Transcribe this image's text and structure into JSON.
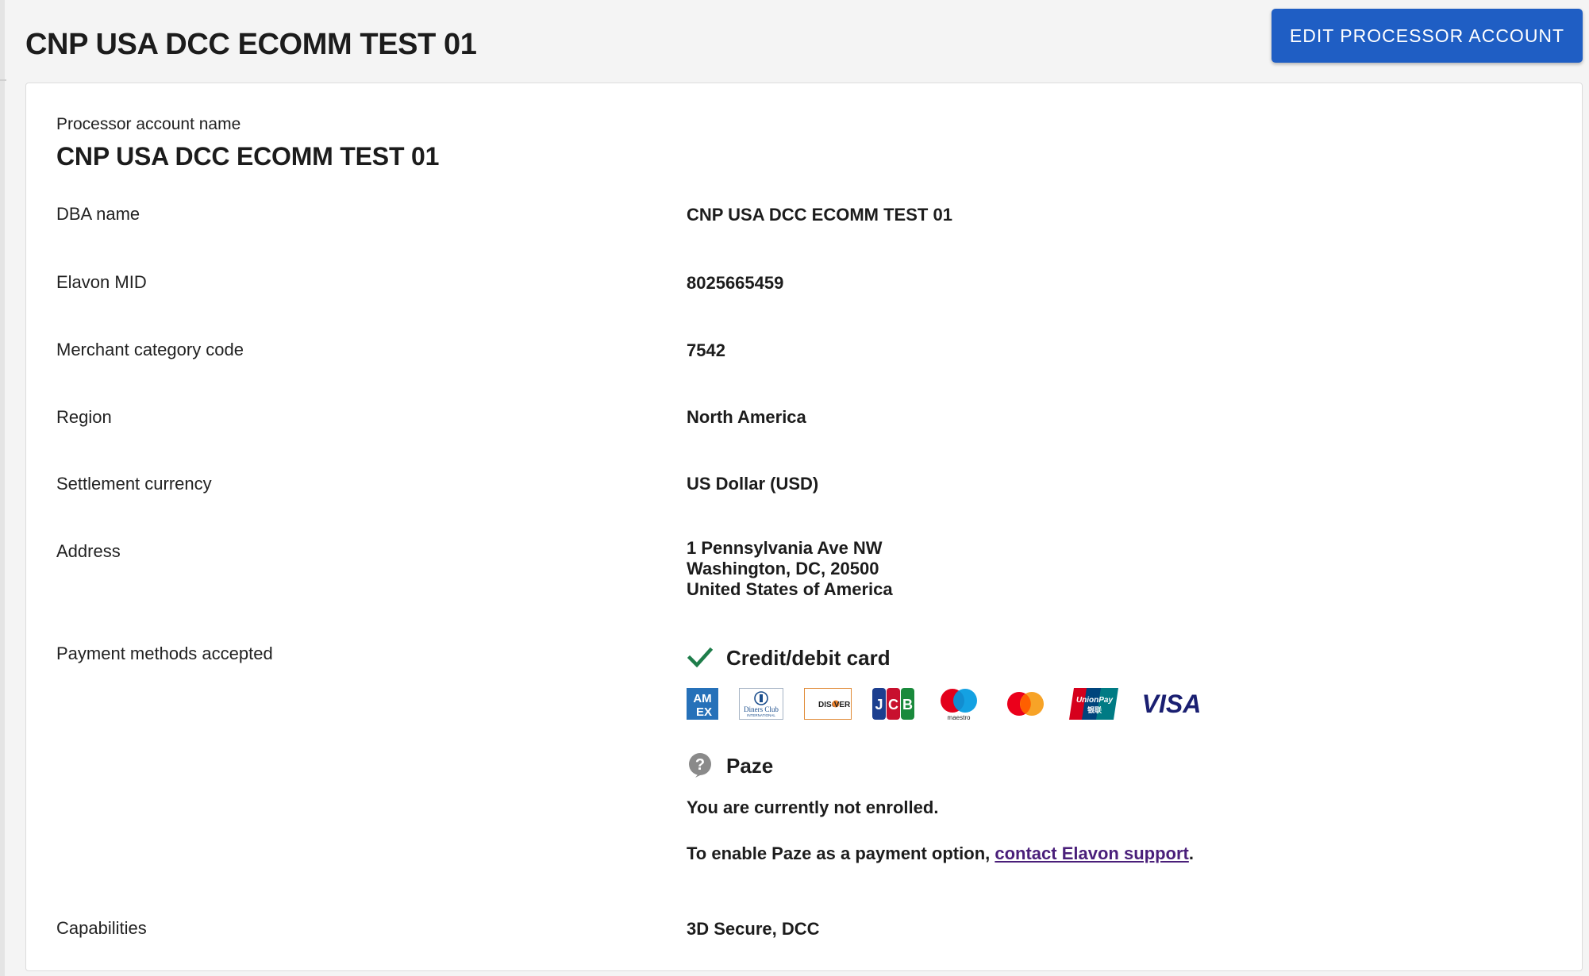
{
  "header": {
    "title": "CNP USA DCC ECOMM TEST 01",
    "edit_button_label": "EDIT PROCESSOR ACCOUNT"
  },
  "processor_account": {
    "name_label": "Processor account name",
    "name_value": "CNP USA DCC ECOMM TEST 01"
  },
  "details": {
    "dba_name": {
      "label": "DBA name",
      "value": "CNP USA DCC ECOMM TEST 01"
    },
    "elavon_mid": {
      "label": "Elavon MID",
      "value": "8025665459"
    },
    "mcc": {
      "label": "Merchant category code",
      "value": "7542"
    },
    "region": {
      "label": "Region",
      "value": "North America"
    },
    "settlement_currency": {
      "label": "Settlement currency",
      "value": "US Dollar (USD)"
    },
    "address": {
      "label": "Address",
      "line1": "1 Pennsylvania Ave NW",
      "line2": "Washington, DC, 20500",
      "line3": "United States of America"
    },
    "capabilities": {
      "label": "Capabilities",
      "value": "3D Secure, DCC"
    }
  },
  "payment_methods": {
    "label": "Payment methods accepted",
    "credit_debit": {
      "title": "Credit/debit card",
      "status_icon": "checkmark-icon",
      "brands": [
        {
          "icon": "amex-logo",
          "text": "AM EX"
        },
        {
          "icon": "diners-club-logo",
          "text": "Diners Club"
        },
        {
          "icon": "discover-logo",
          "text": "DISCOVER"
        },
        {
          "icon": "jcb-logo",
          "text": "JCB"
        },
        {
          "icon": "maestro-logo",
          "text": "maestro"
        },
        {
          "icon": "mastercard-logo",
          "text": ""
        },
        {
          "icon": "unionpay-logo",
          "text": "UnionPay"
        },
        {
          "icon": "visa-logo",
          "text": "VISA"
        }
      ]
    },
    "paze": {
      "title": "Paze",
      "status_icon": "help-circle-icon",
      "not_enrolled": "You are currently not enrolled.",
      "enable_prefix": "To enable Paze as a payment option, ",
      "enable_link": "contact Elavon support",
      "enable_suffix": "."
    }
  },
  "colors": {
    "primary_button": "#1f5ec4",
    "check_green": "#1e7d4a",
    "link_purple": "#4a1f7a",
    "help_gray": "#8a8a8a"
  }
}
